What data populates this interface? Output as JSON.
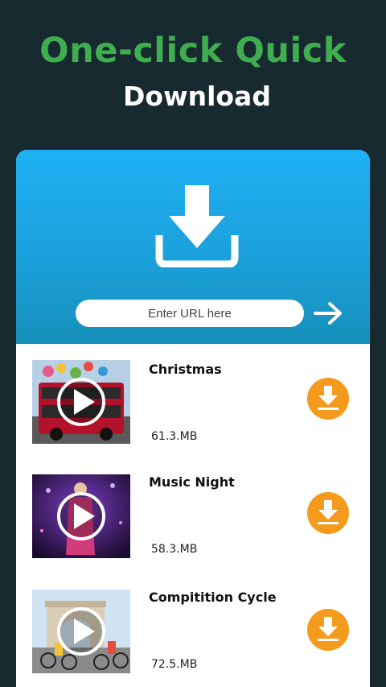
{
  "header": {
    "headline": "One-click Quick",
    "subline": "Download"
  },
  "url_bar": {
    "placeholder": "Enter URL here",
    "value": ""
  },
  "videos": [
    {
      "title": "Christmas",
      "size": "61.3.MB"
    },
    {
      "title": "Music Night",
      "size": "58.3.MB"
    },
    {
      "title": "Compitition Cycle",
      "size": "72.5.MB"
    }
  ],
  "colors": {
    "background": "#172a2f",
    "headline": "#3fae50",
    "banner": "#1fb0f5",
    "download_button": "#f49a1d"
  },
  "icons": {
    "banner": "download-icon",
    "submit": "arrow-right-icon",
    "play": "play-icon",
    "item_download": "download-icon"
  }
}
